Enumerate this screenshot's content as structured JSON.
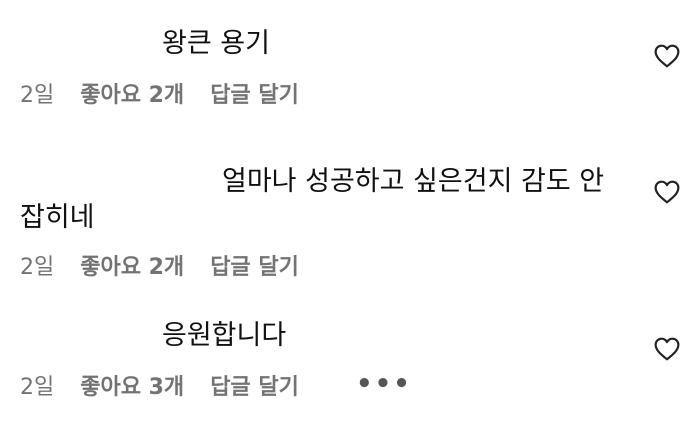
{
  "comments": [
    {
      "text": "왕큰 용기",
      "text_line2": "",
      "time": "2일",
      "likes": "좋아요 2개",
      "reply": "답글 달기",
      "more": ""
    },
    {
      "text": "얼마나 성공하고 싶은건지 감도 안",
      "text_line2": "잡히네",
      "time": "2일",
      "likes": "좋아요 2개",
      "reply": "답글 달기",
      "more": ""
    },
    {
      "text": "응원합니다",
      "text_line2": "",
      "time": "2일",
      "likes": "좋아요 3개",
      "reply": "답글 달기",
      "more": "•••"
    }
  ],
  "icons": {
    "like": "heart-icon",
    "more": "more-options-icon"
  },
  "colors": {
    "text": "#111111",
    "meta": "#737373",
    "icon": "#222222"
  }
}
